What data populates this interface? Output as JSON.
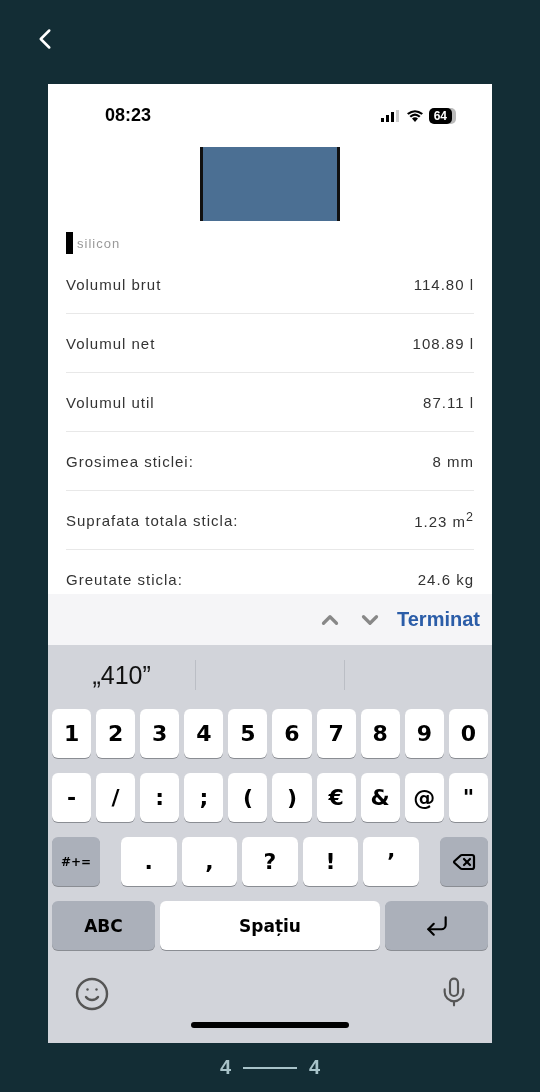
{
  "status_bar": {
    "time": "08:23",
    "battery": "64"
  },
  "product_label": "silicon",
  "rows": [
    {
      "label": "Volumul brut",
      "value": "114.80 l"
    },
    {
      "label": "Volumul net",
      "value": "108.89 l"
    },
    {
      "label": "Volumul util",
      "value": "87.11 l"
    },
    {
      "label": "Grosimea sticlei:",
      "value": "8 mm"
    },
    {
      "label": "Suprafata totala sticla:",
      "value": "1.23 m$^{2}$"
    },
    {
      "label": "Greutate sticla:",
      "value": "24.6 kg"
    }
  ],
  "toolbar": {
    "done": "Terminat"
  },
  "suggestions": [
    "„410”"
  ],
  "keyboard": [
    [
      {
        "kind": "char",
        "label": "1"
      },
      {
        "kind": "char",
        "label": "2"
      },
      {
        "kind": "char",
        "label": "3"
      },
      {
        "kind": "char",
        "label": "4"
      },
      {
        "kind": "char",
        "label": "5"
      },
      {
        "kind": "char",
        "label": "6"
      },
      {
        "kind": "char",
        "label": "7"
      },
      {
        "kind": "char",
        "label": "8"
      },
      {
        "kind": "char",
        "label": "9"
      },
      {
        "kind": "char",
        "label": "0"
      }
    ],
    [
      {
        "kind": "char",
        "label": "-"
      },
      {
        "kind": "char",
        "label": "/"
      },
      {
        "kind": "char",
        "label": ":"
      },
      {
        "kind": "char",
        "label": ";"
      },
      {
        "kind": "char",
        "label": "("
      },
      {
        "kind": "char",
        "label": ")"
      },
      {
        "kind": "char",
        "label": "€"
      },
      {
        "kind": "char",
        "label": "&"
      },
      {
        "kind": "char",
        "label": "@"
      },
      {
        "kind": "char",
        "label": "\""
      }
    ],
    [
      {
        "kind": "function",
        "label": "#+="
      },
      {
        "kind": "wide",
        "label": "."
      },
      {
        "kind": "wide",
        "label": ","
      },
      {
        "kind": "wide",
        "label": "?"
      },
      {
        "kind": "wide",
        "label": "!"
      },
      {
        "kind": "wide",
        "label": "’"
      },
      {
        "kind": "backspace"
      }
    ],
    [
      {
        "kind": "mode",
        "label": "ABC"
      },
      {
        "kind": "space",
        "label": "Spațiu"
      },
      {
        "kind": "return"
      }
    ]
  ],
  "pager": {
    "current": "4",
    "total": "4"
  }
}
